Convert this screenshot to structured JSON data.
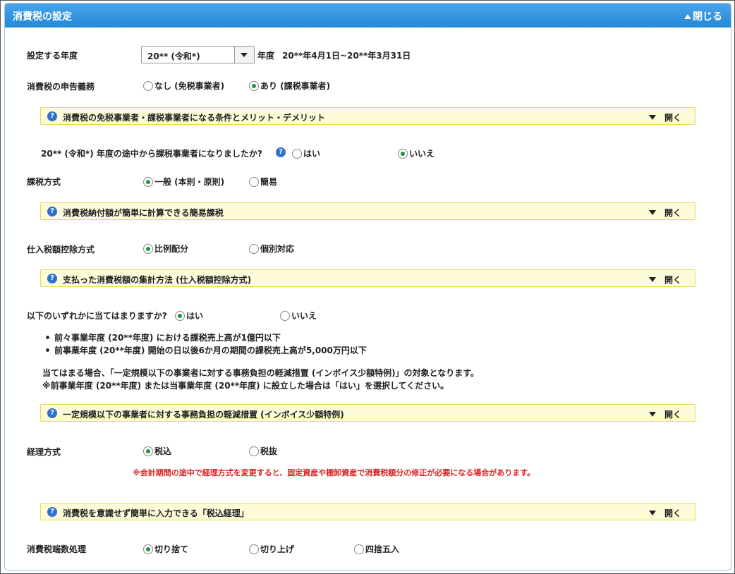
{
  "header": {
    "title": "消費税の設定",
    "close_label": "閉じる"
  },
  "fiscal_year": {
    "label": "設定する年度",
    "selected": "20** (令和*)",
    "suffix": "年度",
    "period": "20**年4月1日~20**年3月31日"
  },
  "filing_obligation": {
    "label": "消費税の申告義務",
    "options": [
      {
        "label": "なし (免税事業者)",
        "selected": false
      },
      {
        "label": "あり (課税事業者)",
        "selected": true
      }
    ]
  },
  "info_bars": [
    {
      "title": "消費税の免税事業者・課税事業者になる条件とメリット・デメリット",
      "toggle": "開く"
    },
    {
      "title": "消費税納付額が簡単に計算できる簡易課税",
      "toggle": "開く"
    },
    {
      "title": "支払った消費税額の集計方法 (仕入税額控除方式)",
      "toggle": "開く"
    },
    {
      "title": "一定規模以下の事業者に対する事務負担の軽減措置 (インボイス少額特例)",
      "toggle": "開く"
    },
    {
      "title": "消費税を意識せず簡単に入力できる「税込経理」",
      "toggle": "開く"
    }
  ],
  "midyear_question": {
    "label": "20** (令和*) 年度の途中から課税事業者になりましたか?",
    "options": [
      {
        "label": "はい",
        "selected": false
      },
      {
        "label": "いいえ",
        "selected": true
      }
    ]
  },
  "tax_method": {
    "label": "課税方式",
    "options": [
      {
        "label": "一般 (本則・原則)",
        "selected": true
      },
      {
        "label": "簡易",
        "selected": false
      }
    ]
  },
  "deduction_method": {
    "label": "仕入税額控除方式",
    "options": [
      {
        "label": "比例配分",
        "selected": true
      },
      {
        "label": "個別対応",
        "selected": false
      }
    ]
  },
  "applicability": {
    "label": "以下のいずれかに当てはまりますか?",
    "options": [
      {
        "label": "はい",
        "selected": true
      },
      {
        "label": "いいえ",
        "selected": false
      }
    ],
    "bullets": [
      "前々事業年度 (20**年度) における課税売上高が1億円以下",
      "前事業年度 (20**年度) 開始の日以後6か月の期間の課税売上高が5,000万円以下"
    ],
    "note1": "当てはまる場合、「一定規模以下の事業者に対する事務負担の軽減措置 (インボイス少額特例)」の対象となります。",
    "note2": "※前事業年度 (20**年度) または当事業年度 (20**年度) に設立した場合は「はい」を選択してください。"
  },
  "accounting_method": {
    "label": "経理方式",
    "options": [
      {
        "label": "税込",
        "selected": true
      },
      {
        "label": "税抜",
        "selected": false
      }
    ],
    "warning": "※会計期間の途中で経理方式を変更すると、固定資産や棚卸資産で消費税額分の修正が必要になる場合があります。"
  },
  "rounding": {
    "label": "消費税端数処理",
    "options": [
      {
        "label": "切り捨て",
        "selected": true
      },
      {
        "label": "切り上げ",
        "selected": false
      },
      {
        "label": "四捨五入",
        "selected": false
      }
    ]
  }
}
